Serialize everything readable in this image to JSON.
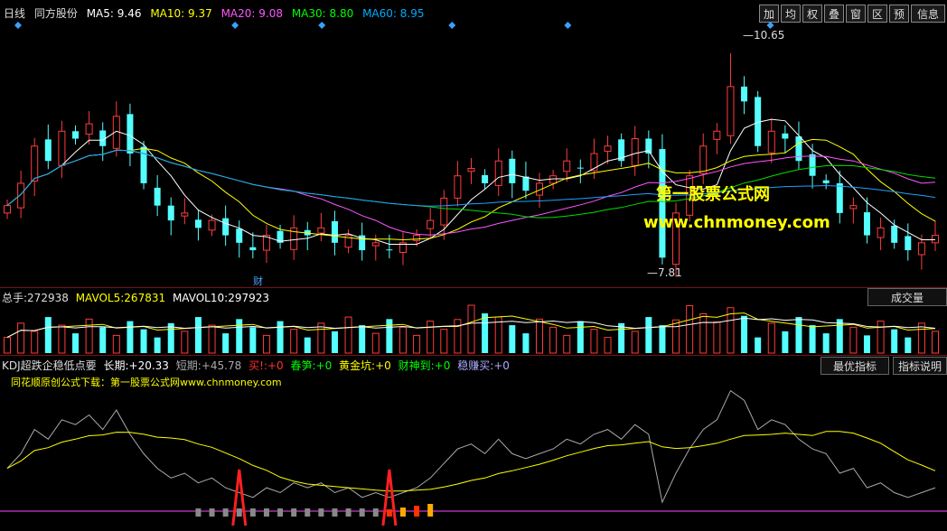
{
  "header": {
    "period": "日线",
    "stock_name": "同方股份",
    "ma": [
      {
        "label": "MA5:",
        "value": "9.46",
        "color": "#ffffff"
      },
      {
        "label": "MA10:",
        "value": "9.37",
        "color": "#ffff00"
      },
      {
        "label": "MA20:",
        "value": "9.08",
        "color": "#ff55ff"
      },
      {
        "label": "MA30:",
        "value": "8.80",
        "color": "#00ff00"
      },
      {
        "label": "MA60:",
        "value": "8.95",
        "color": "#00aaff"
      }
    ],
    "toolbar": [
      "加",
      "均",
      "权",
      "叠",
      "窗",
      "区",
      "预",
      "信息"
    ]
  },
  "watermark": {
    "line1": "第一股票公式网",
    "line2": "www.chnmoney.com"
  },
  "price_marks": {
    "high": "10.65",
    "low": "7.81",
    "cai_marker": "财"
  },
  "volume_panel": {
    "total_label": "总手:",
    "total_value": "272938",
    "mavol5_label": "MAVOL5:",
    "mavol5_value": "267831",
    "mavol10_label": "MAVOL10:",
    "mavol10_value": "297923",
    "button": "成交量"
  },
  "indicator_panel": {
    "name": "KDJ超跌企稳低点要",
    "long_label": "长期:",
    "long_value": "+20.33",
    "short_label": "短期:",
    "short_value": "+45.78",
    "items": [
      {
        "label": "买!:",
        "value": "+0",
        "color": "#ff3030"
      },
      {
        "label": "春笋:",
        "value": "+0",
        "color": "#00ff00"
      },
      {
        "label": "黄金坑:",
        "value": "+0",
        "color": "#ffff00"
      },
      {
        "label": "财神到:",
        "value": "+0",
        "color": "#00ff00"
      },
      {
        "label": "稳赚买:",
        "value": "+0",
        "color": "#aaaaff"
      }
    ],
    "btn_best": "最优指标",
    "btn_desc": "指标说明",
    "source_note": "同花顺原创公式下载：第一股票公式网www.chnmoney.com"
  },
  "chart_data": {
    "type": "candlestick",
    "title": "同方股份 日线",
    "price_range": [
      7.6,
      11.0
    ],
    "highest": 10.65,
    "lowest": 7.81,
    "close": [
      8.6,
      8.9,
      9.4,
      9.2,
      9.6,
      9.5,
      9.7,
      9.4,
      9.8,
      9.3,
      8.9,
      8.6,
      8.4,
      8.5,
      8.3,
      8.4,
      8.2,
      8.1,
      8.0,
      8.2,
      8.1,
      8.3,
      8.2,
      8.3,
      8.1,
      8.2,
      8.0,
      8.1,
      8.0,
      8.1,
      8.2,
      8.4,
      8.7,
      9.0,
      9.1,
      8.9,
      9.2,
      8.9,
      8.8,
      8.9,
      9.0,
      9.2,
      9.1,
      9.3,
      9.4,
      9.2,
      9.5,
      9.3,
      7.9,
      8.5,
      9.0,
      9.4,
      9.6,
      10.2,
      10.0,
      9.4,
      9.6,
      9.5,
      9.2,
      9.0,
      8.9,
      8.5,
      8.6,
      8.2,
      8.3,
      8.1,
      8.0,
      8.1,
      8.2
    ],
    "ma_lines": [
      "MA5",
      "MA10",
      "MA20",
      "MA30",
      "MA60"
    ],
    "kdj_long": 20.33,
    "kdj_short": 45.78
  }
}
